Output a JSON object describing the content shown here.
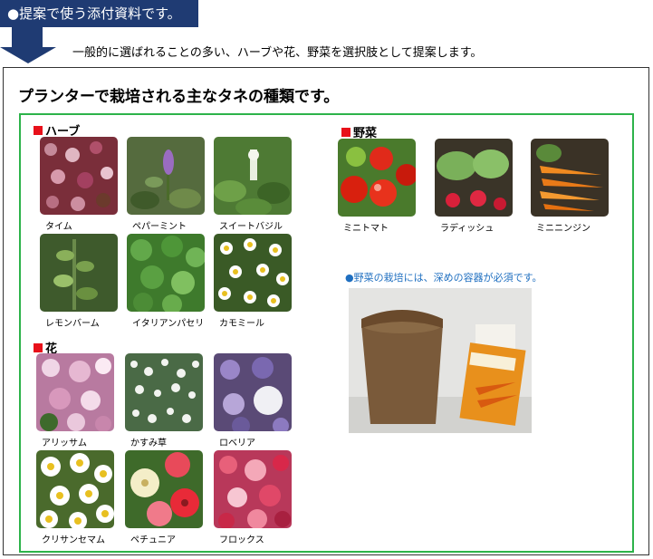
{
  "header": {
    "tag": "●提案で使う添付資料です。",
    "subtitle": "一般的に選ばれることの多い、ハーブや花、野菜を選択肢として提案します。"
  },
  "panel": {
    "title": "プランターで栽培される主なタネの種類です。",
    "sections": {
      "herb": "ハーブ",
      "flower": "花",
      "vegetable": "野菜"
    },
    "herbs": [
      "タイム",
      "ペパーミント",
      "スイートバジル",
      "レモンバーム",
      "イタリアンパセリ",
      "カモミール"
    ],
    "flowers": [
      "アリッサム",
      "かすみ草",
      "ロベリア",
      "クリサンセマム",
      "ペチュニア",
      "フロックス"
    ],
    "vegetables": [
      "ミニトマト",
      "ラディッシュ",
      "ミニニンジン"
    ],
    "note": "●野菜の栽培には、深めの容器が必須です。"
  },
  "colors": {
    "navy": "#1f3b73",
    "green_border": "#2db34a",
    "red_marker": "#e8101a",
    "note_blue": "#1f6fc0"
  }
}
